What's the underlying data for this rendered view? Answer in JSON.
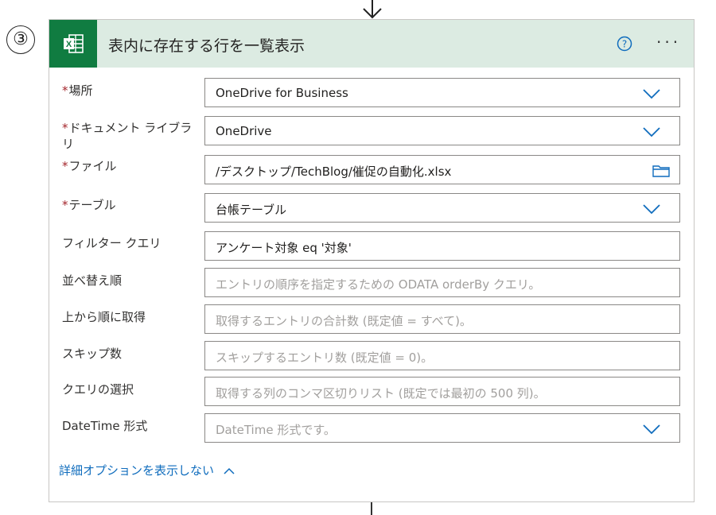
{
  "step": {
    "number": "③"
  },
  "action": {
    "title": "表内に存在する行を一覧表示",
    "icons": {
      "app": "excel-icon",
      "help": "help-icon",
      "more": "more-icon"
    },
    "more_label": "···"
  },
  "fields": [
    {
      "label": "場所",
      "required": true,
      "value": "OneDrive for Business",
      "placeholder": "",
      "control": "dropdown"
    },
    {
      "label": "ドキュメント ライブラリ",
      "required": true,
      "value": "OneDrive",
      "placeholder": "",
      "control": "dropdown"
    },
    {
      "label": "ファイル",
      "required": true,
      "value": "/デスクトップ/TechBlog/催促の自動化.xlsx",
      "placeholder": "",
      "control": "file"
    },
    {
      "label": "テーブル",
      "required": true,
      "value": "台帳テーブル",
      "placeholder": "",
      "control": "dropdown"
    },
    {
      "label": "フィルター クエリ",
      "required": false,
      "value": "アンケート対象 eq '対象'",
      "placeholder": "",
      "control": "text"
    },
    {
      "label": "並べ替え順",
      "required": false,
      "value": "",
      "placeholder": "エントリの順序を指定するための ODATA orderBy クエリ。",
      "control": "text"
    },
    {
      "label": "上から順に取得",
      "required": false,
      "value": "",
      "placeholder": "取得するエントリの合計数 (既定値 = すべて)。",
      "control": "text"
    },
    {
      "label": "スキップ数",
      "required": false,
      "value": "",
      "placeholder": "スキップするエントリ数 (既定値 = 0)。",
      "control": "text"
    },
    {
      "label": "クエリの選択",
      "required": false,
      "value": "",
      "placeholder": "取得する列のコンマ区切りリスト (既定では最初の 500 列)。",
      "control": "text"
    },
    {
      "label": "DateTime 形式",
      "required": false,
      "value": "",
      "placeholder": "DateTime 形式です。",
      "control": "dropdown"
    }
  ],
  "advanced_options": {
    "label": "詳細オプションを表示しない"
  },
  "colors": {
    "header_bg": "#dcebe2",
    "excel_green": "#107c41",
    "link": "#0f6cbd",
    "required": "#a4262c"
  }
}
